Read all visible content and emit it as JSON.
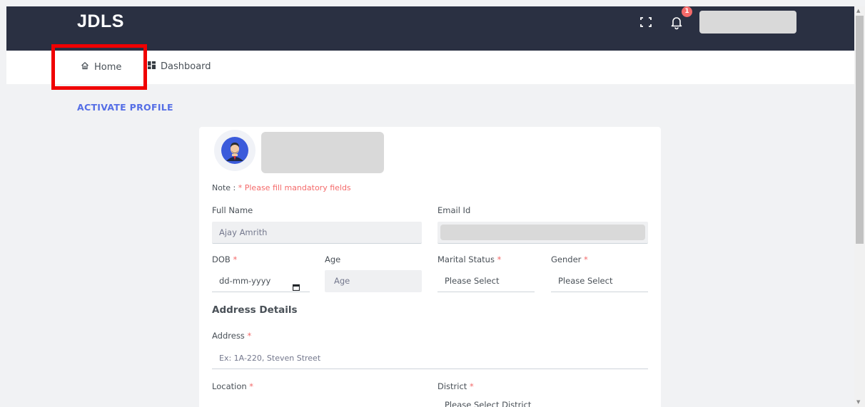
{
  "header": {
    "brand": "JDLS",
    "notification_count": "1"
  },
  "breadcrumb": {
    "home_label": "Home",
    "dashboard_label": "Dashboard"
  },
  "page": {
    "title": "ACTIVATE PROFILE"
  },
  "form": {
    "note_label": "Note : ",
    "note_text": "* Please fill mandatory fields",
    "full_name_label": "Full Name",
    "full_name_value": "Ajay Amrith",
    "email_label": "Email Id",
    "dob_label": "DOB",
    "dob_placeholder": "dd-mm-yyyy",
    "age_label": "Age",
    "age_placeholder": "Age",
    "marital_label": "Marital Status",
    "marital_value": "Please Select",
    "gender_label": "Gender",
    "gender_value": "Please Select",
    "address_heading": "Address Details",
    "address_label": "Address",
    "address_placeholder": "Ex: 1A-220, Steven Street",
    "location_label": "Location",
    "district_label": "District",
    "district_value": "Please Select District",
    "required_marker": "*"
  },
  "colors": {
    "topbar": "#2a3042",
    "accent": "#556ee6",
    "required": "#f46a6a",
    "highlight": "#f00000"
  }
}
